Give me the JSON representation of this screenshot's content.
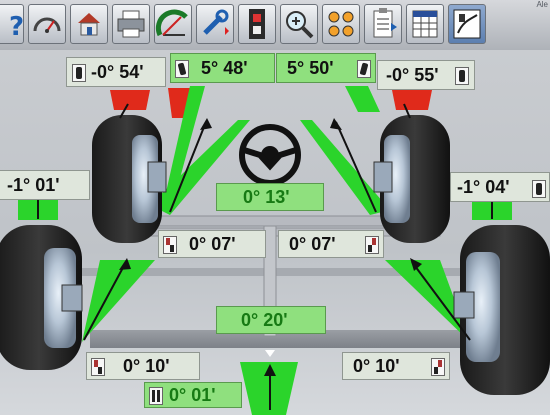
{
  "toolbar": {
    "corner_label": "Ale",
    "buttons": [
      {
        "name": "help-button",
        "icon": "help-icon"
      },
      {
        "name": "gauge-button",
        "icon": "gauge-icon"
      },
      {
        "name": "home-button",
        "icon": "home-icon"
      },
      {
        "name": "print-button",
        "icon": "printer-icon"
      },
      {
        "name": "angle-button",
        "icon": "protractor-icon"
      },
      {
        "name": "adjust-button",
        "icon": "wrench-icon"
      },
      {
        "name": "video-button",
        "icon": "filmstrip-icon"
      },
      {
        "name": "zoom-button",
        "icon": "zoom-in-icon"
      },
      {
        "name": "wheels-button",
        "icon": "wheels-icon"
      },
      {
        "name": "report-button",
        "icon": "clipboard-icon"
      },
      {
        "name": "data-button",
        "icon": "spreadsheet-icon"
      },
      {
        "name": "vehicle-button",
        "icon": "vehicle-icon"
      }
    ]
  },
  "readings": {
    "front_left_camber": "-0° 54'",
    "front_left_caster": "5° 48'",
    "front_right_caster": "5° 50'",
    "front_right_camber": "-0° 55'",
    "steering_wheel": "0° 13'",
    "front_left_toe": "0° 07'",
    "front_right_toe": "0° 07'",
    "rear_left_camber": "-1° 01'",
    "rear_right_camber": "-1° 04'",
    "rear_total_toe": "0° 20'",
    "rear_left_toe": "0° 10'",
    "rear_right_toe": "0° 10'",
    "thrust_angle": "0° 01'"
  },
  "colors": {
    "in_spec": "#2bd42b",
    "out_of_spec": "#e02a1b",
    "value_green": "#177a14"
  }
}
